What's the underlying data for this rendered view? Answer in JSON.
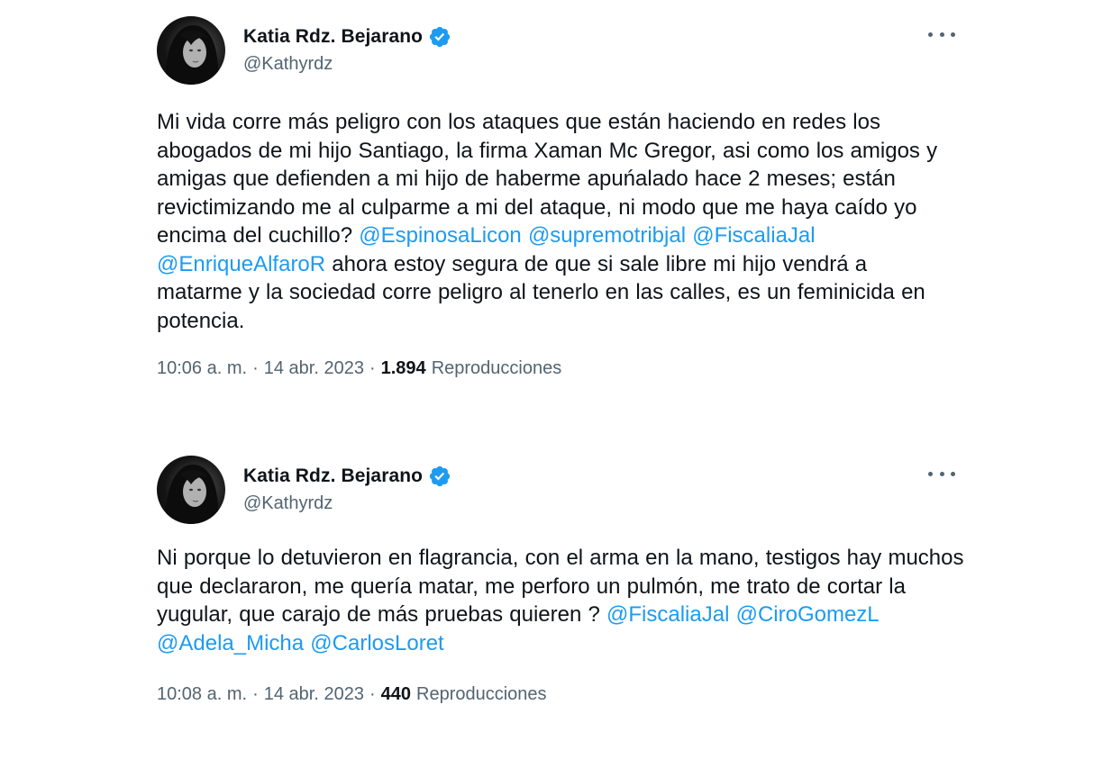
{
  "tweets": [
    {
      "author_name": "Katia Rdz. Bejarano",
      "handle": "@Kathyrdz",
      "text_parts": [
        {
          "type": "text",
          "value": "Mi vida corre más peligro con los ataques que están haciendo en redes los abogados de mi hijo Santiago, la firma Xaman Mc Gregor, asi como los amigos y amigas que defienden a mi hijo de haberme apuńalado hace 2 meses; están revictimizando me al culparme a mi del ataque, ni modo que me haya caído yo encima del cuchillo? "
        },
        {
          "type": "mention",
          "value": "@EspinosaLicon"
        },
        {
          "type": "text",
          "value": " "
        },
        {
          "type": "mention",
          "value": "@supremotribjal"
        },
        {
          "type": "text",
          "value": " "
        },
        {
          "type": "mention",
          "value": "@FiscaliaJal"
        },
        {
          "type": "text",
          "value": " "
        },
        {
          "type": "mention",
          "value": "@EnriqueAlfaroR"
        },
        {
          "type": "text",
          "value": " ahora estoy segura de que si sale libre mi hijo vendrá a matarme y la sociedad corre peligro al tenerlo en las calles, es un feminicida en potencia."
        }
      ],
      "time": "10:06 a. m.",
      "date": "14 abr. 2023",
      "views_count": "1.894",
      "views_label": "Reproducciones"
    },
    {
      "author_name": "Katia Rdz. Bejarano",
      "handle": "@Kathyrdz",
      "text_parts": [
        {
          "type": "text",
          "value": "Ni porque lo detuvieron en flagrancia, con el arma en la mano, testigos hay muchos que declararon, me quería matar, me perforo un pulmón, me trato de cortar la yugular, que carajo de más pruebas quieren ? "
        },
        {
          "type": "mention",
          "value": "@FiscaliaJal"
        },
        {
          "type": "text",
          "value": " "
        },
        {
          "type": "mention",
          "value": "@CiroGomezL"
        },
        {
          "type": "text",
          "value": " "
        },
        {
          "type": "mention",
          "value": "@Adela_Micha"
        },
        {
          "type": "text",
          "value": " "
        },
        {
          "type": "mention",
          "value": "@CarlosLoret"
        }
      ],
      "time": "10:08 a. m.",
      "date": "14 abr. 2023",
      "views_count": "440",
      "views_label": "Reproducciones"
    }
  ],
  "icons": {
    "verified": "verified-badge-icon",
    "more": "more-options-icon"
  },
  "colors": {
    "mention": "#1d9bf0",
    "secondary_text": "#536471",
    "primary_text": "#0f1419",
    "verified": "#1d9bf0"
  },
  "separator": "·"
}
